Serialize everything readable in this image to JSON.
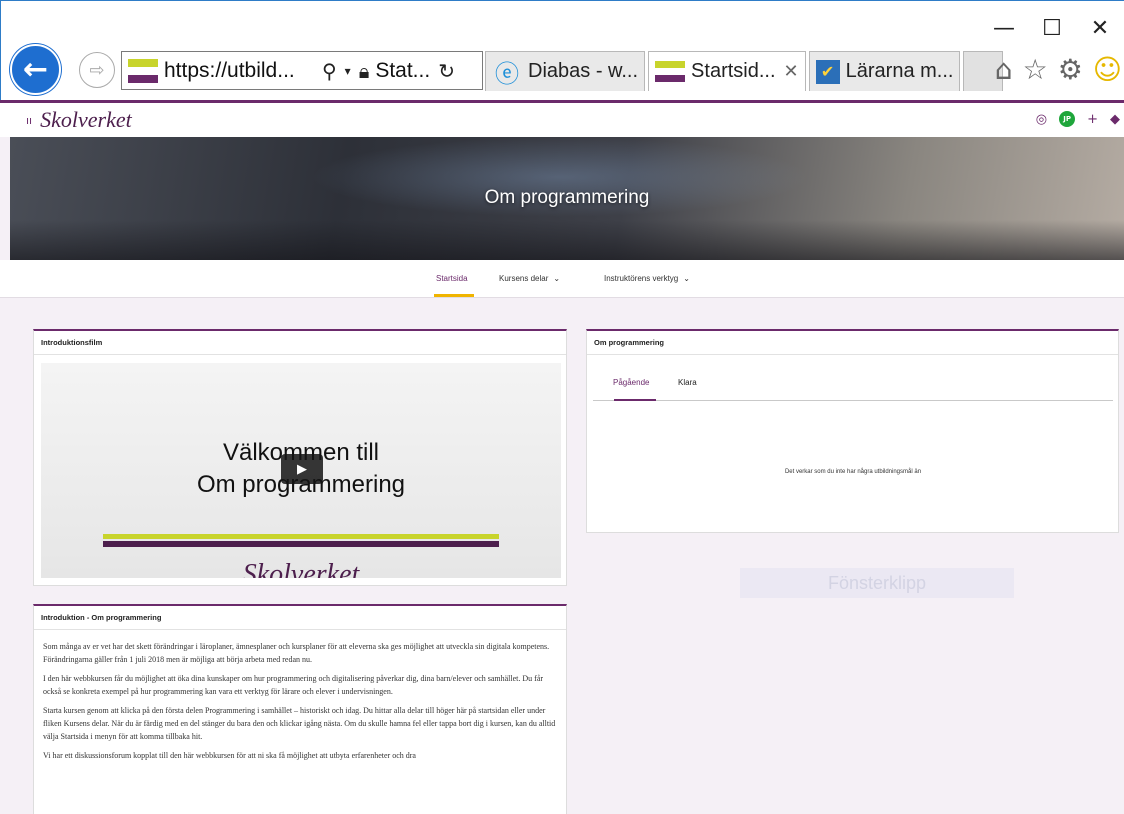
{
  "browser": {
    "window_controls": {
      "minimize": "—",
      "maximize": "☐",
      "close": "✕"
    },
    "address": {
      "url": "https://utbild...",
      "site": "Stat..."
    },
    "tabs": [
      {
        "label": "Diabas - w...",
        "icon": "ie-icon",
        "active": false
      },
      {
        "label": "Startsid...",
        "icon": "skolverket-flag-icon",
        "active": true,
        "close": "✕"
      },
      {
        "label": "Lärarna m...",
        "icon": "app-icon",
        "active": false
      }
    ],
    "toolbar_icons": [
      "home-icon",
      "star-icon",
      "gear-icon",
      "smiley-icon"
    ]
  },
  "site": {
    "logo_mark": "ıı",
    "logo_text": "Skolverket",
    "avatar_initials": "JP"
  },
  "hero": {
    "title": "Om programmering"
  },
  "nav": {
    "items": [
      {
        "label": "Startsida",
        "active": true
      },
      {
        "label": "Kursens delar",
        "dropdown": true
      },
      {
        "label": "Instruktörens verktyg",
        "dropdown": true
      }
    ]
  },
  "video_card": {
    "title": "Introduktionsfilm",
    "video_line1": "Välkommen till",
    "video_line2": "Om programmering",
    "video_logo": "Skolverket"
  },
  "intro_card": {
    "title": "Introduktion - Om programmering",
    "paragraphs": [
      "Som många av er vet har det skett förändringar i läroplaner, ämnesplaner och kursplaner för att eleverna ska ges möjlighet att utveckla sin digitala kompetens. Förändringarna gäller från 1 juli 2018 men är möjliga att börja arbeta med redan nu.",
      "I den här webbkursen får du möjlighet att öka dina kunskaper om hur programmering och digitalisering påverkar dig, dina barn/elever och samhället. Du får också se konkreta exempel på hur programmering kan vara ett verktyg för lärare och elever i undervisningen.",
      "Starta kursen genom att klicka på den första delen Programmering i samhället – historiskt och idag. Du hittar alla delar till höger här på startsidan eller under fliken Kursens delar. När du är färdig med en del stänger du bara den och klickar igång nästa. Om du skulle hamna fel eller tappa bort dig i kursen, kan du alltid välja Startsida i menyn för att komma tillbaka hit.",
      "Vi har ett diskussionsforum kopplat till den här webbkursen för att ni ska få möjlighet att utbyta erfarenheter och dra"
    ]
  },
  "goals_card": {
    "title": "Om programmering",
    "tabs": [
      {
        "label": "Pågående",
        "active": true
      },
      {
        "label": "Klara",
        "active": false
      }
    ],
    "empty_message": "Det verkar som du inte har några utbildningsmål än"
  },
  "overlay": {
    "snip_label": "Fönsterklipp"
  },
  "colors": {
    "brand": "#6b2a6b",
    "accent_yellow": "#f0b400",
    "ie_blue": "#1e6ed0"
  }
}
